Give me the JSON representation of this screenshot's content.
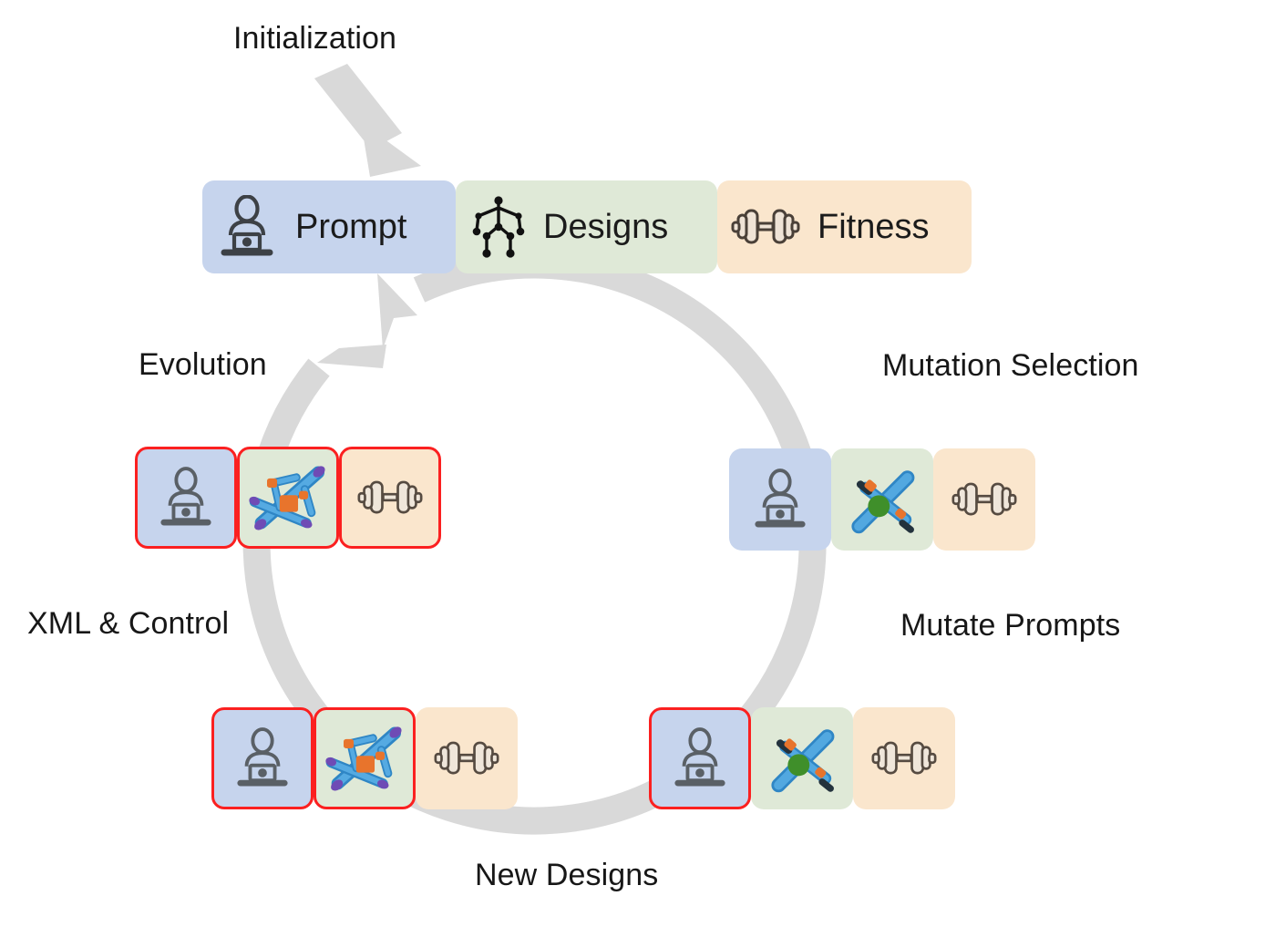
{
  "diagram": {
    "title": "Evolutionary design loop",
    "background": "#ffffff",
    "ring_color": "#d8d8d8",
    "selection_color": "#fb2020",
    "text_color": "#171717",
    "palette": {
      "prompt_blue": "#c6d4ed",
      "designs_green": "#dfe9d7",
      "fitness_peach": "#fae6cd"
    }
  },
  "labels": {
    "initialization": "Initialization",
    "evolution": "Evolution",
    "mutation_selection": "Mutation Selection",
    "xml_control": "XML & Control",
    "mutate_prompts": "Mutate Prompts",
    "new_designs": "New Designs"
  },
  "stages": {
    "prompt": {
      "label": "Prompt",
      "icon": "person-at-laptop-icon",
      "color": "#c6d4ed"
    },
    "designs": {
      "label": "Designs",
      "icon": "stick-figure-skeleton-icon",
      "color": "#dfe9d7"
    },
    "fitness": {
      "label": "Fitness",
      "icon": "dumbbell-icon",
      "color": "#fae6cd"
    }
  },
  "groups": [
    {
      "id": "evolution",
      "label": "Evolution",
      "cells": [
        {
          "icon": "person-at-laptop-icon",
          "color": "blue",
          "selected": true
        },
        {
          "icon": "robot-design-complex-icon",
          "color": "green",
          "selected": true
        },
        {
          "icon": "dumbbell-icon",
          "color": "peach",
          "selected": true
        }
      ]
    },
    {
      "id": "mutation-selection",
      "label": "Mutation Selection",
      "cells": [
        {
          "icon": "person-at-laptop-icon",
          "color": "blue",
          "selected": false
        },
        {
          "icon": "robot-design-simple-icon",
          "color": "green",
          "selected": false
        },
        {
          "icon": "dumbbell-icon",
          "color": "peach",
          "selected": false
        }
      ]
    },
    {
      "id": "xml-control",
      "label": "XML & Control",
      "cells": [
        {
          "icon": "person-at-laptop-icon",
          "color": "blue",
          "selected": true
        },
        {
          "icon": "robot-design-complex-icon",
          "color": "green",
          "selected": true
        },
        {
          "icon": "dumbbell-icon",
          "color": "peach",
          "selected": false
        }
      ]
    },
    {
      "id": "mutate-prompts",
      "label": "Mutate Prompts",
      "cells": [
        {
          "icon": "person-at-laptop-icon",
          "color": "blue",
          "selected": true
        },
        {
          "icon": "robot-design-simple-icon",
          "color": "green",
          "selected": false
        },
        {
          "icon": "dumbbell-icon",
          "color": "peach",
          "selected": false
        }
      ]
    }
  ],
  "arrows": [
    {
      "name": "initialization-arrow",
      "direction": "down-right",
      "target": "prompt"
    },
    {
      "name": "cycle-ring-arrow",
      "direction": "clockwise",
      "target": "prompt"
    }
  ]
}
